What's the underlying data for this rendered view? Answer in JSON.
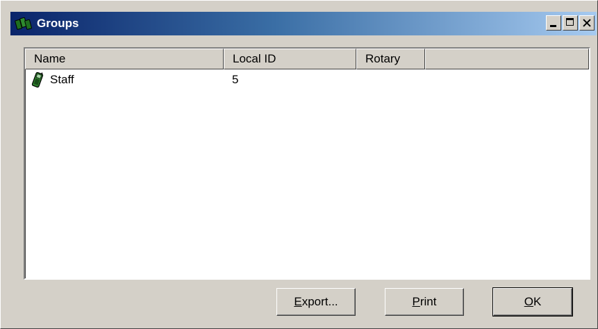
{
  "window": {
    "title": "Groups"
  },
  "list": {
    "columns": [
      "Name",
      "Local ID",
      "Rotary",
      ""
    ],
    "rows": [
      {
        "name": "Staff",
        "local_id": "5",
        "rotary": ""
      }
    ]
  },
  "buttons": {
    "export": {
      "accel": "E",
      "rest": "xport..."
    },
    "print": {
      "accel": "P",
      "rest": "rint"
    },
    "ok": {
      "accel": "O",
      "rest": "K"
    }
  },
  "icons": {
    "app": "phone-group-icon",
    "row": "phone-icon"
  }
}
